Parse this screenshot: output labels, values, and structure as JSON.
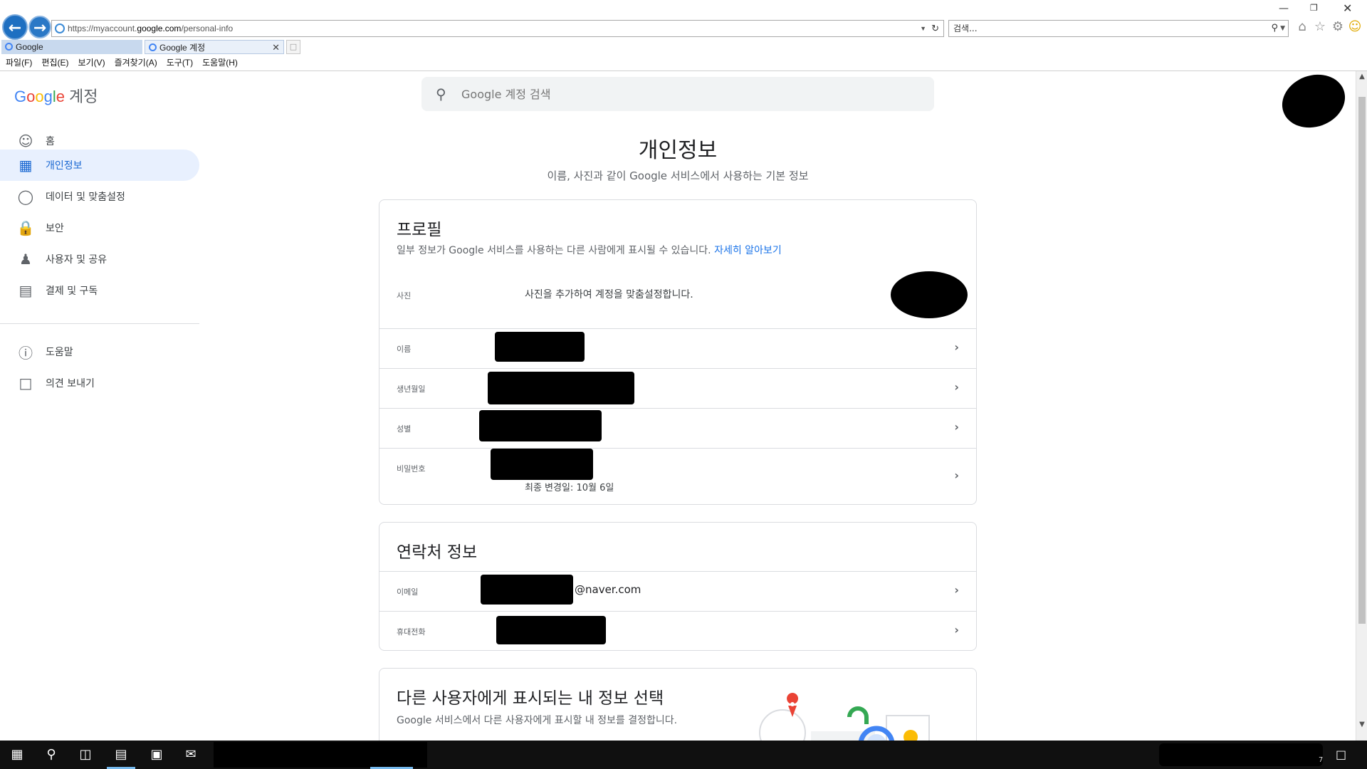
{
  "browser": {
    "url_prefix": "https://myaccount.",
    "url_host": "google.com",
    "url_path": "/personal-info",
    "search_placeholder": "검색...",
    "tabs": [
      {
        "label": "Google"
      },
      {
        "label": "Google 계정"
      }
    ],
    "menu": [
      "파일(F)",
      "편집(E)",
      "보기(V)",
      "즐겨찾기(A)",
      "도구(T)",
      "도움말(H)"
    ]
  },
  "header": {
    "logo_letters": [
      "G",
      "o",
      "o",
      "g",
      "l",
      "e"
    ],
    "logo_suffix": "계정",
    "search_placeholder": "Google 계정 검색"
  },
  "sidebar": {
    "items": [
      {
        "label": "홈",
        "icon": "account-circle-icon"
      },
      {
        "label": "개인정보",
        "icon": "id-card-icon",
        "active": true
      },
      {
        "label": "데이터 및 맞춤설정",
        "icon": "toggle-icon"
      },
      {
        "label": "보안",
        "icon": "lock-icon"
      },
      {
        "label": "사용자 및 공유",
        "icon": "people-icon"
      },
      {
        "label": "결제 및 구독",
        "icon": "credit-card-icon"
      },
      {
        "label": "도움말",
        "icon": "help-icon"
      },
      {
        "label": "의견 보내기",
        "icon": "feedback-icon"
      }
    ]
  },
  "main": {
    "title": "개인정보",
    "subtitle": "이름, 사진과 같이 Google 서비스에서 사용하는 기본 정보",
    "profile": {
      "title": "프로필",
      "desc": "일부 정보가 Google 서비스를 사용하는 다른 사람에게 표시될 수 있습니다.",
      "learn_more": "자세히 알아보기",
      "photo_label": "사진",
      "photo_text": "사진을 추가하여 계정을 맞춤설정합니다.",
      "rows": [
        {
          "label": "이름"
        },
        {
          "label": "생년월일"
        },
        {
          "label": "성별"
        },
        {
          "label": "비밀번호",
          "sub": "최종 변경일: 10월 6일"
        }
      ]
    },
    "contact": {
      "title": "연락처 정보",
      "rows": [
        {
          "label": "이메일",
          "value_suffix": "@naver.com"
        },
        {
          "label": "휴대전화"
        }
      ]
    },
    "visibility": {
      "title": "다른 사용자에게 표시되는 내 정보 선택",
      "desc": "Google 서비스에서 다른 사용자에게 표시할 내 정보를 결정합니다."
    }
  },
  "taskbar": {
    "tray_number": "7"
  },
  "colors": {
    "accent": "#1a73e8",
    "active_bg": "#e8f0fe",
    "active_text": "#1967d2",
    "ie_blue": "#1e6fc1",
    "taskbar": "#101010"
  }
}
